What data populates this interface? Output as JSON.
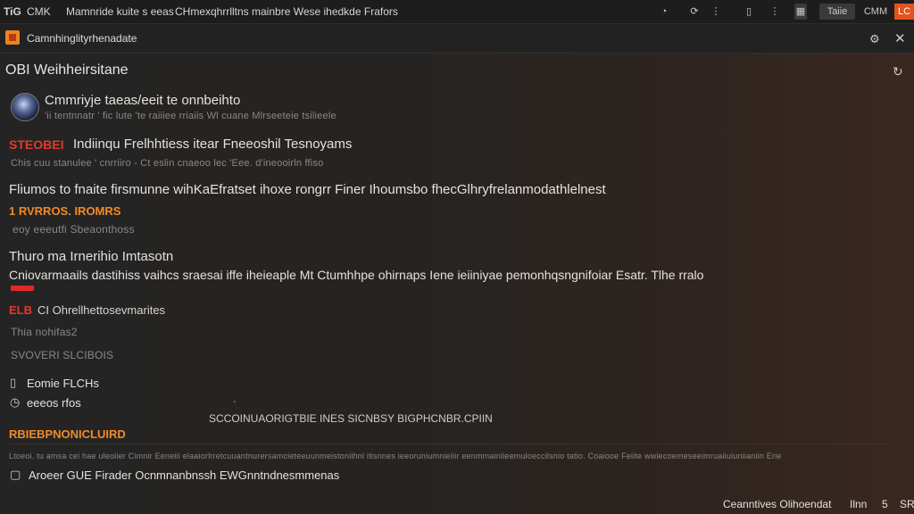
{
  "titlebar": {
    "app": "TiG",
    "menu1": "CMK",
    "title": "Mamnride kuite s eeas",
    "subtitle": "CHmexqhrrlltns mainbre Wese ihedkde Frafors",
    "right_tab": "Taiie",
    "right_label": "CMM",
    "badge": "LC"
  },
  "header": {
    "channel": "Camnhinglityrhenadate",
    "section": "OBI Weihheirsitane"
  },
  "post": {
    "author_line": "Cmmriyje taeas/eeit te onnbeihto",
    "meta": "'ii tentnnatr ' fic lute 'te raiiiee rriaiis Wl cuane Mlrseeteie tsilieele",
    "tag": "STEOBEI",
    "headline": "Indiinqu Frelhhtiess itear Fneeoshil Tesnoyams",
    "headline_meta": "Chis cuu stanulee ' cnrriiro - Ct eslin cnaeoo lec 'Eee. d'ineooirln ffiso",
    "body": "Fliumos to fnaite firsmunne wihKaEfratset ihoxe rongrr Finer Ihoumsbo fhecGlhryfrelanmodathlelnest",
    "highlight": "1 RVRROS. IROMRS",
    "sub_small": "eoy eeeutfi Sbeaonthoss",
    "section_title": "Thuro ma Irnerihio Imtasotn",
    "long_line": "Cniovarmaails dastihiss vaihcs sraesai iffe iheieaple Mt Ctumhhpe ohirnaps Iene ieiiniyae pemonhqsngnifoiar Esatr. Tlhe rralo",
    "badge": "ELB",
    "badge_text": "CI Ohrellhettosevmarites",
    "small_line": "Thia nohifas2",
    "caps_line": "SVOVERI SLCIBOIS",
    "item1_label": "Eomie FLCHs",
    "item2_label": "eeeos rfos",
    "caption": "SCCOINUAORIGTBIE INES SICNBSY BIGPHCNBR.CPIIN",
    "footer_heading": "RBIEBPNONICLUIRD",
    "footer_meta": "Ltoeoi. tu amsa cei hae uleoiier Cimnir Eeneiii elaaiorlrretcuuantnurersamcieteeuunmeistoniihnl itisnnes ieeoruniumnieiiir eenmmainlieemuloeccilsnio tatio. Coaiooe Feiite wwiecoemeseeimruaiiuiuniianiin Erie",
    "footer_link": "Aroeer GUE Firader Ocnmnanbnssh EWGnntndnesmmenas"
  },
  "statusbar": {
    "left": "Ceanntives Olihoendat",
    "mid": "Ilnn",
    "num": "5",
    "right": "SR"
  },
  "colors": {
    "accent": "#f08a2a",
    "alert": "#e23a2a",
    "background": "#262422"
  }
}
